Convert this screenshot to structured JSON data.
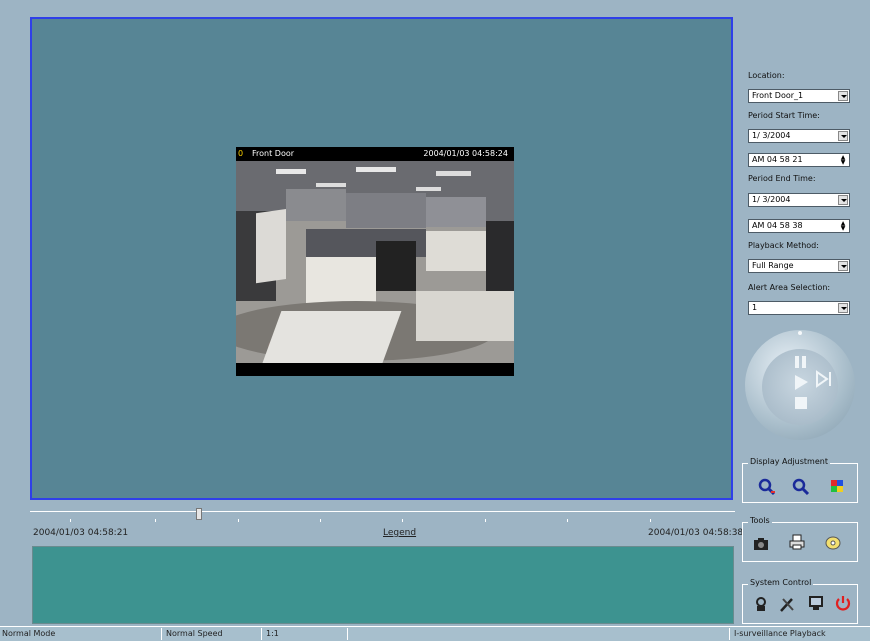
{
  "video": {
    "channel": "0",
    "camera_name": "Front Door",
    "timestamp": "2004/01/03 04:58:24"
  },
  "controls": {
    "location_label": "Location:",
    "location_value": "Front Door_1",
    "period_start_label": "Period Start Time:",
    "period_start_date": "1/ 3/2004",
    "period_start_time": "AM 04 58 21",
    "period_end_label": "Period End Time:",
    "period_end_date": "1/ 3/2004",
    "period_end_time": "AM 04 58 38",
    "playback_method_label": "Playback Method:",
    "playback_method_value": "Full Range",
    "alert_area_label": "Alert Area Selection:",
    "alert_area_value": "1"
  },
  "timeline": {
    "start": "2004/01/03 04:58:21",
    "legend": "Legend",
    "end": "2004/01/03 04:58:38",
    "position_fraction": 0.24
  },
  "groups": {
    "display_adjustment": "Display Adjustment",
    "tools": "Tools",
    "system_control": "System Control"
  },
  "status": {
    "mode": "Normal Mode",
    "speed": "Normal Speed",
    "ratio": "1:1",
    "app": "I-surveillance Playback"
  },
  "icons": {
    "zoom_in": "zoom-in-icon",
    "zoom_out": "zoom-out-icon",
    "color_adjust": "color-adjust-icon",
    "camera": "camera-icon",
    "print": "print-icon",
    "disc": "disc-icon",
    "network": "network-icon",
    "tools": "tools-icon",
    "monitor": "monitor-icon",
    "power": "power-icon"
  },
  "colors": {
    "viewer_bg": "#578595",
    "viewer_border": "#2f3fe8",
    "legend_bg": "#3d9390",
    "power": "#e02020"
  }
}
